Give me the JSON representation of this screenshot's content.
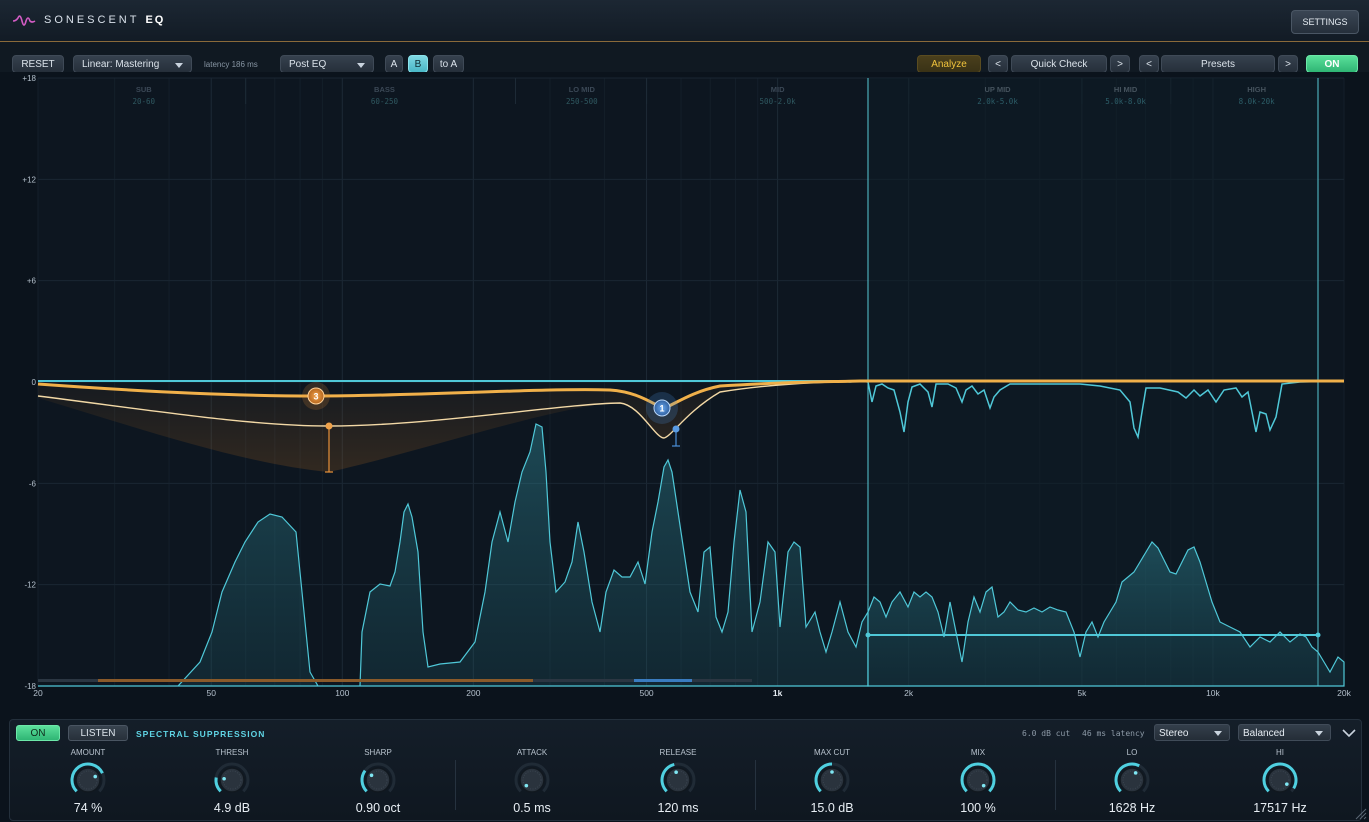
{
  "app": {
    "brand": "SONESCENT",
    "product": "EQ",
    "settings_label": "SETTINGS"
  },
  "toolbar": {
    "reset_label": "RESET",
    "mode_value": "Linear: Mastering",
    "latency_text": "latency 186 ms",
    "position_value": "Post EQ",
    "a_label": "A",
    "b_label": "B",
    "to_a_label": "to A",
    "analyze_label": "Analyze",
    "quickcheck_prev": "<",
    "quickcheck_label": "Quick Check",
    "quickcheck_next": ">",
    "presets_prev": "<",
    "presets_label": "Presets",
    "presets_next": ">",
    "on_label": "ON"
  },
  "graph": {
    "db_labels": [
      "+18",
      "+12",
      "+6",
      "0",
      "-6",
      "-12",
      "-18"
    ],
    "freq_labels": [
      "20",
      "50",
      "100",
      "200",
      "500",
      "1k",
      "2k",
      "5k",
      "10k",
      "20k"
    ],
    "bands": [
      {
        "name": "SUB",
        "range": "20-60"
      },
      {
        "name": "BASS",
        "range": "60-250"
      },
      {
        "name": "LO MID",
        "range": "250-500"
      },
      {
        "name": "MID",
        "range": "500-2.0k"
      },
      {
        "name": "UP MID",
        "range": "2.0k-5.0k"
      },
      {
        "name": "HI MID",
        "range": "5.0k-8.0k"
      },
      {
        "name": "HIGH",
        "range": "8.0k-20k"
      }
    ],
    "nodes": [
      {
        "label": "3",
        "freq_hz": 88,
        "gain_db": -0.9,
        "color": "#e8913a"
      },
      {
        "label": "1",
        "freq_hz": 600,
        "gain_db": -1.6,
        "color": "#4a8fd8"
      }
    ]
  },
  "colors": {
    "eq_curve": "#f0b04a",
    "spectrum": "#4fc8d8",
    "accent_green": "#3ec983",
    "accent_cyan": "#5fd4e4"
  },
  "panel": {
    "on_label": "ON",
    "listen_label": "LISTEN",
    "title": "SPECTRAL SUPPRESSION",
    "cut_text": "6.0 dB cut",
    "latency_text": "46 ms latency",
    "stereo_value": "Stereo",
    "quality_value": "Balanced",
    "knobs": [
      {
        "label": "AMOUNT",
        "value": "74 %",
        "level": 0.74
      },
      {
        "label": "THRESH",
        "value": "4.9 dB",
        "level": 0.2
      },
      {
        "label": "SHARP",
        "value": "0.90 oct",
        "level": 0.3
      },
      {
        "label": "ATTACK",
        "value": "0.5 ms",
        "level": 0.0
      },
      {
        "label": "RELEASE",
        "value": "120 ms",
        "level": 0.45
      },
      {
        "label": "MAX CUT",
        "value": "15.0 dB",
        "level": 0.5
      },
      {
        "label": "MIX",
        "value": "100 %",
        "level": 1.0
      },
      {
        "label": "LO",
        "value": "1628 Hz",
        "level": 0.6
      },
      {
        "label": "HI",
        "value": "17517 Hz",
        "level": 0.95
      }
    ]
  }
}
